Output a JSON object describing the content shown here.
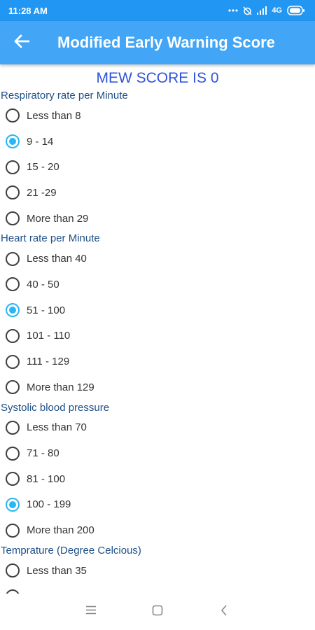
{
  "status_bar": {
    "time": "11:28 AM",
    "network": "4G",
    "icons": [
      "more-dots-icon",
      "alarm-off-icon",
      "signal-icon",
      "battery-icon"
    ]
  },
  "app_bar": {
    "title": "Modified Early Warning Score",
    "back_icon": "back-arrow-icon",
    "color": "#42a5f5"
  },
  "score_text": "MEW SCORE IS 0",
  "sections": {
    "respiratory": {
      "label": "Respiratory rate per Minute",
      "options": [
        "Less than 8",
        "9 - 14",
        "15 - 20",
        "21 -29",
        "More than 29"
      ],
      "selected": "9 - 14"
    },
    "heart": {
      "label": "Heart rate per Minute",
      "options": [
        "Less than 40",
        "40 - 50",
        "51 - 100",
        "101 - 110",
        "111 - 129",
        "More than 129"
      ],
      "selected": "51 - 100"
    },
    "systolic": {
      "label": "Systolic blood pressure",
      "options": [
        "Less than 70",
        "71 - 80",
        "81 - 100",
        "100 - 199",
        "More than 200"
      ],
      "selected": "100 - 199"
    },
    "temperature": {
      "label": "Temprature (Degree Celcious)",
      "options": [
        "Less than 35",
        ""
      ]
    }
  },
  "colors": {
    "accent": "#29b6f6",
    "status_bar": "#2196f3",
    "score_text": "#2f54d9",
    "section_label": "#1d4f86"
  },
  "nav_bar": {
    "icons": [
      "menu-icon",
      "home-square-icon",
      "back-chevron-icon"
    ]
  }
}
